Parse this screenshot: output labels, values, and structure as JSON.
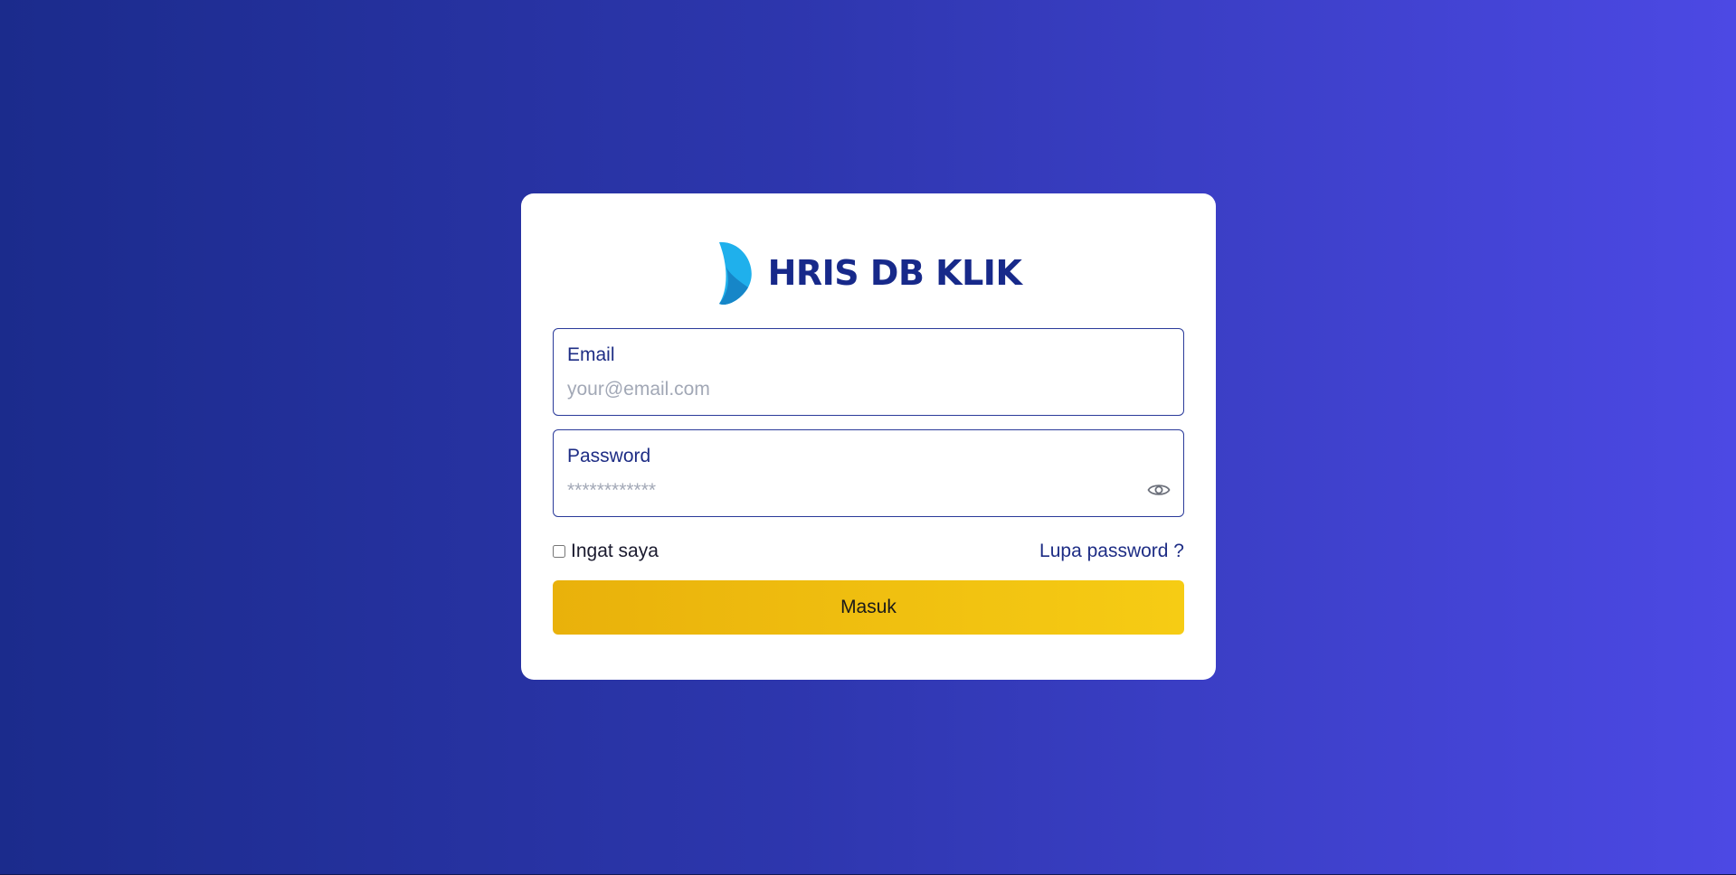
{
  "brand": {
    "name": "HRIS DB KLIK",
    "logo_icon": "leaf-logo-icon",
    "colors": {
      "name": "#17298a",
      "logo_primary": "#1fb0ec",
      "logo_secondary": "#1686c8"
    }
  },
  "form": {
    "email": {
      "label": "Email",
      "placeholder": "your@email.com",
      "value": ""
    },
    "password": {
      "label": "Password",
      "placeholder": "************",
      "value": "",
      "toggle_icon": "eye-icon"
    },
    "remember": {
      "label": "Ingat saya",
      "checked": false
    },
    "forgot_label": "Lupa password ?",
    "submit_label": "Masuk"
  },
  "theme": {
    "background_start": "#1b2b8c",
    "background_end": "#4c49e4",
    "accent": "#2a3a9a",
    "button_start": "#e9b10b",
    "button_end": "#f6cc14"
  }
}
